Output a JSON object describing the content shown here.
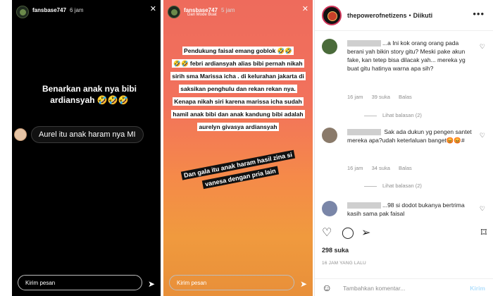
{
  "story1": {
    "username": "fansbase747",
    "time": "6 jam",
    "main_text": "Benarkan anak nya bibi ardiansyah 🤣🤣🤣",
    "comment_text": "Aurel itu anak haram nya MI",
    "message_placeholder": "Kirim pesan"
  },
  "story2": {
    "username": "fansbase747",
    "time": "5 jam",
    "subtitle": "Dari Mode Buat",
    "lines": [
      "Pendukung faisal emang goblok 🤣🤣",
      "🤣🤣 febri ardiansyah alias bibi pernah nikah sirih  sma Marissa icha . di kelurahan jakarta di saksikan penghulu dan rekan rekan nya.",
      "Kenapa nikah siri karena marissa icha sudah hamil anak bibi dan anak kandung bibi adalah aurelyn givasya ardiansyah"
    ],
    "rotated_text": "Dan gala itu anak haram hasil zina si vanesa dengan pria lain",
    "message_placeholder": "Kirim pesan"
  },
  "panel": {
    "username": "thepowerofnetizens",
    "follow_label": "Diikuti",
    "comments": [
      {
        "username_fragment": "...a",
        "text": "Ini kok orang orang pada berani yah bikin story gitu? Meski pake akun fake, kan tetep bisa dilacak yah... mereka yg buat gitu hatinya warna apa sih?",
        "time": "16 jam",
        "likes": "39 suka",
        "reply": "Balas",
        "replies": "Lihat balasan (2)",
        "avatar_color": "#4a6b3a"
      },
      {
        "username_fragment": "",
        "text": "Sak ada dukun yg pengen santet mereka apa?udah keterlaluan banget😡😡#",
        "time": "16 jam",
        "likes": "34 suka",
        "reply": "Balas",
        "replies": "Lihat balasan (2)",
        "avatar_color": "#8a7a6a"
      },
      {
        "username_fragment": "...98",
        "text": "si dodot bukanya bertrima kasih sama pak faisal",
        "avatar_color": "#7a86a8"
      }
    ],
    "likes_count": "298 suka",
    "time_ago": "16 JAM YANG LALU",
    "add_comment_placeholder": "Tambahkan komentar...",
    "post_label": "Kirim"
  }
}
